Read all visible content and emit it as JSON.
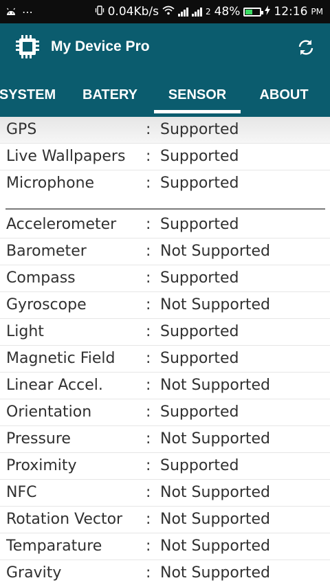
{
  "status_bar": {
    "speed": "0.04Kb/s",
    "sim2": "2",
    "battery_percent": "48%",
    "battery_level": 0.48,
    "time": "12:16",
    "ampm": "PM"
  },
  "app_bar": {
    "title": "My Device Pro",
    "color": "#0b5c6e"
  },
  "tabs": [
    {
      "label": "SYSTEM",
      "selected": false
    },
    {
      "label": "BATERY",
      "selected": false
    },
    {
      "label": "SENSOR",
      "selected": true
    },
    {
      "label": "ABOUT",
      "selected": false
    }
  ],
  "rows": [
    {
      "name": "GPS",
      "colon": ":",
      "value": "Supported"
    },
    {
      "name": "Live Wallpapers",
      "colon": ":",
      "value": "Supported"
    },
    {
      "name": "Microphone",
      "colon": ":",
      "value": "Supported"
    },
    {
      "name": "Accelerometer",
      "colon": ":",
      "value": "Supported"
    },
    {
      "name": "Barometer",
      "colon": ":",
      "value": "Not Supported"
    },
    {
      "name": "Compass",
      "colon": ":",
      "value": "Supported"
    },
    {
      "name": "Gyroscope",
      "colon": ":",
      "value": "Not Supported"
    },
    {
      "name": "Light",
      "colon": ":",
      "value": "Supported"
    },
    {
      "name": "Magnetic Field",
      "colon": ":",
      "value": "Supported"
    },
    {
      "name": "Linear Accel.",
      "colon": ":",
      "value": "Not Supported"
    },
    {
      "name": "Orientation",
      "colon": ":",
      "value": "Supported"
    },
    {
      "name": "Pressure",
      "colon": ":",
      "value": "Not Supported"
    },
    {
      "name": "Proximity",
      "colon": ":",
      "value": "Supported"
    },
    {
      "name": "NFC",
      "colon": ":",
      "value": "Not Supported"
    },
    {
      "name": "Rotation Vector",
      "colon": ":",
      "value": "Not Supported"
    },
    {
      "name": "Temparature",
      "colon": ":",
      "value": "Not Supported"
    },
    {
      "name": "Gravity",
      "colon": ":",
      "value": "Not Supported"
    }
  ]
}
